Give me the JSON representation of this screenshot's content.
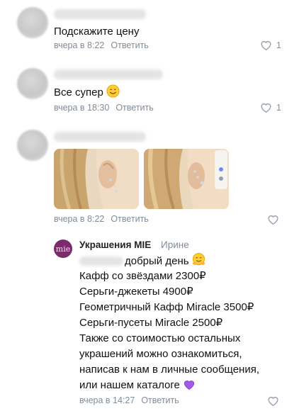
{
  "comments": [
    {
      "text": "Подскажите цену",
      "time": "вчера в 8:22",
      "reply_label": "Ответить",
      "likes": "1"
    },
    {
      "text": "Все супер",
      "time": "вчера в 18:30",
      "reply_label": "Ответить",
      "likes": "1"
    },
    {
      "time": "вчера в 8:22",
      "reply_label": "Ответить",
      "photos": 2
    }
  ],
  "reply": {
    "author": "Украшения MIE",
    "addressee": "Ирине",
    "avatar_text": "mie",
    "lines": [
      "добрый день",
      "Кафф со звёздами 2300₽",
      "Серьги-джекеты 4900₽",
      "Геометричный Кафф Miracle 3500₽",
      "Серьги-пусеты Miracle 2500₽",
      "Также со стоимостью остальных",
      "украшений можно ознакомиться,",
      "написав к нам в личные сообщения,",
      "или нашем каталоге"
    ],
    "time": "вчера в 14:27",
    "reply_label": "Ответить"
  },
  "colors": {
    "meta": "#818c99",
    "brand": "#7b2a6b"
  },
  "icons": [
    "heart-outline-icon",
    "smile-emoji-icon",
    "hug-emoji-icon",
    "purple-heart-emoji-icon"
  ]
}
